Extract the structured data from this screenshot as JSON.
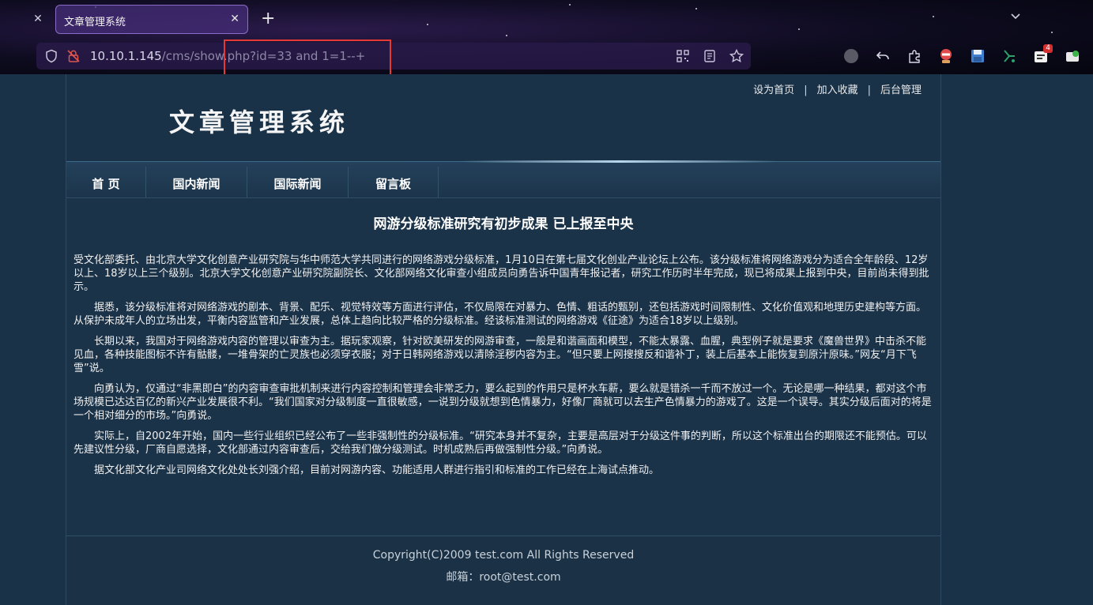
{
  "browser": {
    "tab_title": "文章管理系统",
    "url_host": "10.10.1.145",
    "url_path": "/cms/show.php?id=33 and 1=1--+",
    "accent": "#8a6cc8",
    "highlight_color": "#e53935",
    "extension_badge": "4"
  },
  "header": {
    "logo": "文章管理系统",
    "links": [
      "设为首页",
      "加入收藏",
      "后台管理"
    ],
    "separator": "|"
  },
  "nav": {
    "items": [
      "首 页",
      "国内新闻",
      "国际新闻",
      "留言板"
    ]
  },
  "article": {
    "title": "网游分级标准研究有初步成果 已上报至中央",
    "paragraphs": [
      "受文化部委托、由北京大学文化创意产业研究院与华中师范大学共同进行的网络游戏分级标准，1月10日在第七届文化创业产业论坛上公布。该分级标准将网络游戏分为适合全年龄段、12岁以上、18岁以上三个级别。北京大学文化创意产业研究院副院长、文化部网络文化审查小组成员向勇告诉中国青年报记者，研究工作历时半年完成，现已将成果上报到中央，目前尚未得到批示。",
      "据悉，该分级标准将对网络游戏的剧本、背景、配乐、视觉特效等方面进行评估，不仅局限在对暴力、色情、粗话的甄别，还包括游戏时间限制性、文化价值观和地理历史建构等方面。从保护未成年人的立场出发，平衡内容监管和产业发展，总体上趋向比较严格的分级标准。经该标准测试的网络游戏《征途》为适合18岁以上级别。",
      "长期以来，我国对于网络游戏内容的管理以审查为主。据玩家观察，针对欧美研发的网游审查，一般是和谐画面和模型，不能太暴露、血腥，典型例子就是要求《魔兽世界》中击杀不能见血，各种技能图标不许有骷髅，一堆骨架的亡灵族也必须穿衣服；对于日韩网络游戏以清除淫秽内容为主。“但只要上网搜搜反和谐补丁，装上后基本上能恢复到原汁原味。”网友“月下飞雪”说。",
      "向勇认为，仅通过“非黑即白”的内容审查审批机制来进行内容控制和管理会非常乏力，要么起到的作用只是杯水车薪，要么就是错杀一千而不放过一个。无论是哪一种结果，都对这个市场规模已达达百亿的新兴产业发展很不利。“我们国家对分级制度一直很敏感，一说到分级就想到色情暴力，好像厂商就可以去生产色情暴力的游戏了。这是一个误导。其实分级后面对的将是一个相对细分的市场。”向勇说。",
      "实际上，自2002年开始，国内一些行业组织已经公布了一些非强制性的分级标准。“研究本身并不复杂，主要是高层对于分级这件事的判断，所以这个标准出台的期限还不能预估。可以先建议性分级，厂商自愿选择，文化部通过内容审查后，交给我们做分级测试。时机成熟后再做强制性分级。”向勇说。",
      "据文化部文化产业司网络文化处处长刘强介绍，目前对网游内容、功能适用人群进行指引和标准的工作已经在上海试点推动。"
    ]
  },
  "footer": {
    "copyright": "Copyright(C)2009 test.com All Rights Reserved",
    "email": "邮箱：root@test.com"
  }
}
